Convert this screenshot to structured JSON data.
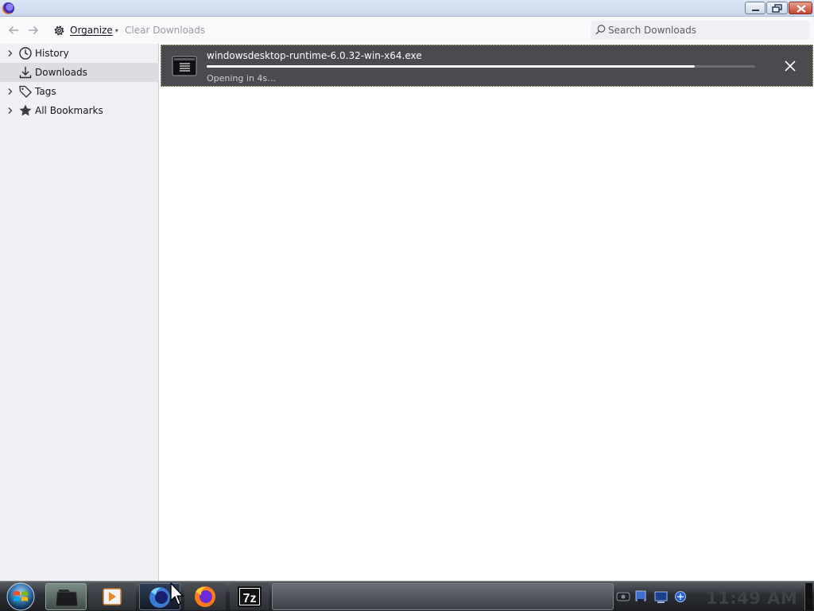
{
  "window": {
    "title": ""
  },
  "toolbar": {
    "organize_label": "Organize",
    "organize_caret": "▾",
    "clear_label": "Clear Downloads",
    "search_placeholder": "Search Downloads"
  },
  "sidebar": {
    "items": [
      {
        "label": "History",
        "icon": "clock-icon",
        "expandable": true,
        "selected": false
      },
      {
        "label": "Downloads",
        "icon": "download-icon",
        "expandable": false,
        "selected": true
      },
      {
        "label": "Tags",
        "icon": "tag-icon",
        "expandable": true,
        "selected": false
      },
      {
        "label": "All Bookmarks",
        "icon": "star-icon",
        "expandable": true,
        "selected": false
      }
    ]
  },
  "downloads": [
    {
      "file_name": "windowsdesktop-runtime-6.0.32-win-x64.exe",
      "status": "Opening in 4s…",
      "progress": 0.89
    }
  ],
  "taskbar": {
    "clock": "11:49 AM",
    "seven_zip_label": "7z",
    "apps": [
      "start-orb",
      "file-explorer-icon",
      "media-player-icon",
      "firefox-developer-icon",
      "firefox-icon",
      "7zip-icon"
    ],
    "tray_icons": [
      "tray-hardware-icon",
      "tray-network-icon",
      "tray-display-icon",
      "tray-security-icon"
    ]
  },
  "colors": {
    "download_item_bg": "#4a4a4f",
    "sidebar_bg": "#f0f0f4",
    "selected_bg": "#dcdce3"
  }
}
